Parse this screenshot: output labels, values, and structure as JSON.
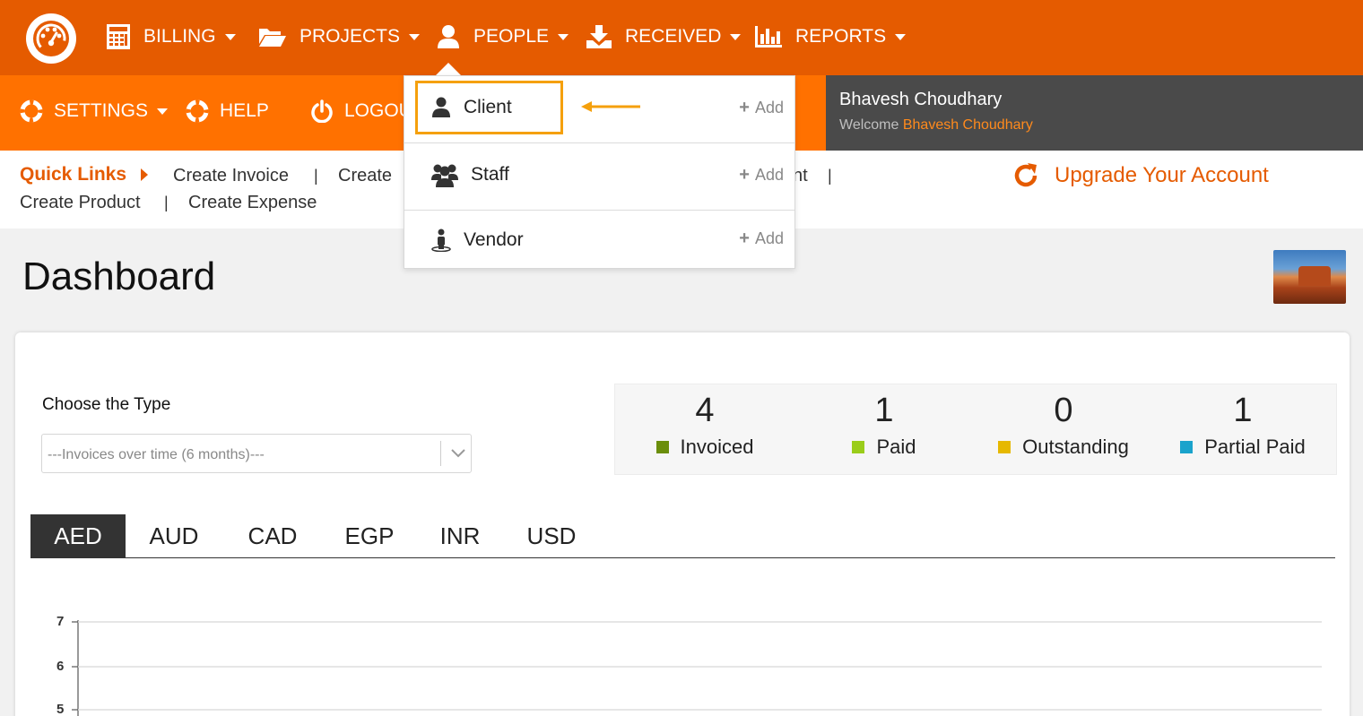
{
  "topnav": {
    "items": [
      {
        "label": "BILLING",
        "icon": "calculator-icon"
      },
      {
        "label": "PROJECTS",
        "icon": "folder-open-icon"
      },
      {
        "label": "PEOPLE",
        "icon": "user-icon"
      },
      {
        "label": "RECEIVED",
        "icon": "download-icon"
      },
      {
        "label": "REPORTS",
        "icon": "bar-chart-icon"
      }
    ]
  },
  "subnav": {
    "items": [
      {
        "label": "SETTINGS",
        "icon": "lifebuoy-icon"
      },
      {
        "label": "HELP",
        "icon": "lifebuoy-icon"
      },
      {
        "label": "LOGOUT",
        "icon": "power-icon"
      }
    ]
  },
  "user": {
    "name": "Bhavesh Choudhary",
    "welcome_prefix": "Welcome",
    "welcome_name": "Bhavesh Choudhary"
  },
  "quicklinks": {
    "title": "Quick Links",
    "links": [
      "Create Invoice",
      "Create",
      "nt",
      "Create Product",
      "Create Expense"
    ],
    "upgrade": "Upgrade Your Account"
  },
  "page": {
    "title": "Dashboard"
  },
  "filter": {
    "label": "Choose the Type",
    "selected": "---Invoices over time (6 months)---"
  },
  "stats": [
    {
      "value": "4",
      "label": "Invoiced",
      "color": "#6b8e0b"
    },
    {
      "value": "1",
      "label": "Paid",
      "color": "#9acd1a"
    },
    {
      "value": "0",
      "label": "Outstanding",
      "color": "#e6b800"
    },
    {
      "value": "1",
      "label": "Partial Paid",
      "color": "#1aa3cc"
    }
  ],
  "currency_tabs": [
    "AED",
    "AUD",
    "CAD",
    "EGP",
    "INR",
    "USD"
  ],
  "active_tab": "AED",
  "chart_data": {
    "type": "line",
    "y_ticks": [
      "7",
      "6",
      "5"
    ],
    "grid": true
  },
  "people_menu": {
    "items": [
      {
        "label": "Client",
        "add": "Add",
        "icon": "user-icon"
      },
      {
        "label": "Staff",
        "add": "Add",
        "icon": "users-icon"
      },
      {
        "label": "Vendor",
        "add": "Add",
        "icon": "vendor-icon"
      }
    ]
  },
  "colors": {
    "brand": "#e55b00",
    "brand_light": "#ff7100",
    "dark": "#4a4a4a",
    "highlight": "#f5a00c"
  }
}
